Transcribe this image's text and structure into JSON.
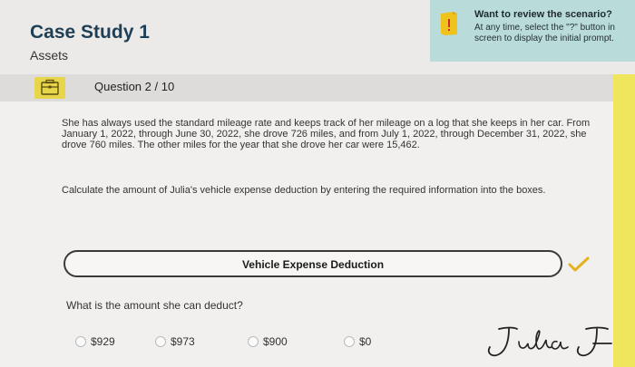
{
  "header": {
    "title": "Case Study 1",
    "subtitle": "Assets"
  },
  "hint": {
    "title": "Want to review the scenario?",
    "text": "At any time, select the \"?\" button in screen to display the initial prompt.",
    "icon": "book-alert-icon",
    "color": "#b9dcdb"
  },
  "question_bar": {
    "label": "Question 2 / 10",
    "icon": "briefcase-icon"
  },
  "scenario": {
    "paragraph1": "She has always used the standard mileage rate and keeps track of her mileage on a log that she keeps in her car. From January 1, 2022, through June 30, 2022, she drove 726 miles, and from July 1, 2022, through December 31, 2022, she drove 760 miles. The other miles for the year that she drove her car were 15,462.",
    "paragraph2": "Calculate the amount of Julia's vehicle expense deduction by entering the required information into the boxes."
  },
  "section": {
    "label": "Vehicle Expense Deduction",
    "status_icon": "check-icon",
    "status_color": "#e3b21c"
  },
  "question": {
    "text": "What is the amount she can deduct?",
    "options": [
      "$929",
      "$973",
      "$900",
      "$0"
    ]
  },
  "colors": {
    "title": "#1f3f57",
    "accent_strip": "#f0e65e",
    "briefcase": "#e8d64a"
  }
}
